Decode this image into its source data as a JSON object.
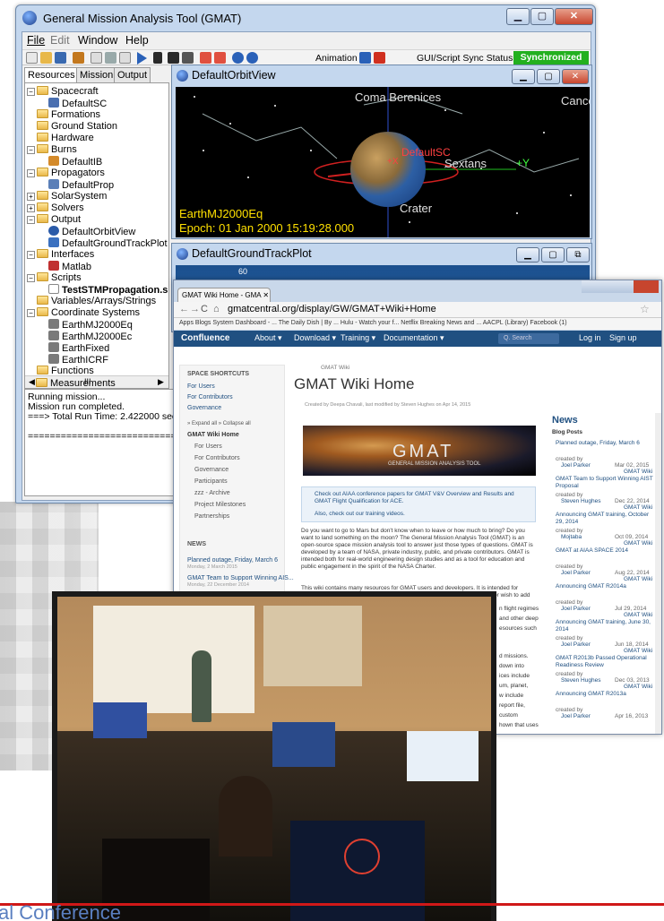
{
  "gmat": {
    "title": "General Mission Analysis Tool (GMAT)",
    "menu": [
      "File",
      "Edit",
      "Window",
      "Help"
    ],
    "toolbar": {
      "animation_label": "Animation",
      "sync_label": "GUI/Script Sync Status:",
      "sync_status": "Synchronized",
      "sync_color": "#22b01f"
    },
    "tabs": [
      "Resources",
      "Mission",
      "Output"
    ],
    "tree": [
      "Spacecraft",
      "DefaultSC",
      "Formations",
      "Ground Station",
      "Hardware",
      "Burns",
      "DefaultIB",
      "Propagators",
      "DefaultProp",
      "SolarSystem",
      "Solvers",
      "Output",
      "DefaultOrbitView",
      "DefaultGroundTrackPlot",
      "Interfaces",
      "Matlab",
      "Scripts",
      "TestSTMPropagation.s",
      "Variables/Arrays/Strings",
      "Coordinate Systems",
      "EarthMJ2000Eq",
      "EarthMJ2000Ec",
      "EarthFixed",
      "EarthICRF",
      "Functions",
      "Measurements"
    ],
    "tree_scroll": "III",
    "output_lines": [
      "Running mission...",
      "Mission run completed.",
      "===> Total Run Time: 2.422000 second",
      "",
      "================================"
    ],
    "orbit_view": {
      "title": "DefaultOrbitView",
      "constellations": [
        "Coma Berenices",
        "Cance",
        "Sextans",
        "Crater"
      ],
      "spacecraft_label": "DefaultSC",
      "axis_label": "+Y",
      "axis_x_label": "+X",
      "coord_label": "EarthMJ2000Eq",
      "epoch_label": "Epoch: 01 Jan 2000 15:19:28.000"
    },
    "ground_track": {
      "title": "DefaultGroundTrackPlot",
      "lat_label": "60"
    }
  },
  "browser": {
    "tab_title": "GMAT Wiki Home - GMA",
    "url": "gmatcentral.org/display/GW/GMAT+Wiki+Home",
    "bookmarks": "Apps   Blogs   System Dashboard - ...   The Daily Dish | By ...   Hulu - Watch your f...   Netflix   Breaking News and ...   AACPL (Library)   Facebook (1)",
    "nav": [
      "Confluence",
      "About ▾",
      "Download ▾",
      "Training ▾",
      "Documentation ▾"
    ],
    "search_placeholder": "Q. Search",
    "login": "Log in",
    "signup": "Sign up",
    "sidebar": {
      "heading": "SPACE SHORTCUTS",
      "shortcuts": [
        "For Users",
        "For Contributors",
        "Governance"
      ],
      "expand": "» Expand all   » Collapse all",
      "tree_title": "GMAT Wiki Home",
      "tree": [
        "For Users",
        "For Contributors",
        "Governance",
        "Participants",
        "zzz - Archive",
        "Project Milestones",
        "Partnerships"
      ],
      "news_heading": "NEWS",
      "news": [
        "Planned outage, Friday, March 6",
        "Monday, 2 March 2015",
        "GMAT Team to Support Winning AIS...",
        "Monday, 22 December 2014"
      ]
    },
    "content": {
      "breadcrumb": "GMAT Wiki",
      "title": "GMAT Wiki Home",
      "byline": "Created by Deepa Chavali, last modified by Steven Hughes on Apr 14, 2015",
      "banner_title": "GMAT",
      "banner_subtitle": "GENERAL MISSION ANALYSIS TOOL",
      "info1": "Check out AIAA conference papers for GMAT V&V Overview and Results and GMAT Flight Qualification for ACE.",
      "info2": "Also, check out our training videos.",
      "para1": "Do you want to go to Mars but don't know when to leave or how much to bring?  Do you want to land something on the moon? The General Mission Analysis Tool (GMAT) is an open-source space mission analysis tool to answer just those types of questions. GMAT is developed by a team of NASA, private industry, public, and private contributors. GMAT is intended both for real-world engineering design studies and as a tool for education and public engagement in the spirit of the NASA Charter.",
      "para2": "This wiki contains many resources for GMAT users and developers. It is intended for collaboration! If you see anything wrong with any of the pages on this wiki, or wish to add GMAT-related information on your own, please feel free to contribute."
    },
    "news": {
      "heading": "News",
      "sub": "Blog Posts",
      "items": [
        {
          "title": "Planned outage, Friday, March 6",
          "by": "created by",
          "author": "Joel Parker",
          "date": "Mar 02, 2015",
          "space": "GMAT Wiki"
        },
        {
          "title": "GMAT Team to Support Winning AIST Proposal",
          "by": "created by",
          "author": "Steven Hughes",
          "date": "Dec 22, 2014",
          "space": "GMAT Wiki"
        },
        {
          "title": "Announcing GMAT training, October 29, 2014",
          "by": "created by",
          "author": "Mojtaba",
          "date": "Oct 09, 2014",
          "space": "GMAT Wiki"
        },
        {
          "title": "GMAT at AIAA SPACE 2014",
          "by": "created by",
          "author": "Joel Parker",
          "date": "Aug 22, 2014",
          "space": "GMAT Wiki"
        },
        {
          "title": "Announcing GMAT R2014a",
          "by": "created by",
          "author": "Joel Parker",
          "date": "Jul 29, 2014",
          "space": "GMAT Wiki"
        },
        {
          "title": "Announcing GMAT training, June 30, 2014",
          "by": "created by",
          "author": "Joel Parker",
          "date": "Jun 18, 2014",
          "space": "GMAT Wiki"
        },
        {
          "title": "GMAT R2013b Passed Operational Readiness Review",
          "by": "created by",
          "author": "Steven Hughes",
          "date": "Dec 03, 2013",
          "space": "GMAT Wiki"
        },
        {
          "title": "Announcing GMAT R2013a",
          "by": "created by",
          "author": "Joel Parker",
          "date": "Apr 16, 2013",
          "space": ""
        }
      ]
    },
    "cut_text": [
      "n flight regimes",
      "and other deep",
      "esources such",
      "d missions.",
      "down into",
      "ices include",
      "um, planet,",
      "w include",
      "report file,",
      "custom",
      "hown that uses"
    ]
  },
  "footer": {
    "conference": "al Conference",
    "line_color": "#d01818"
  }
}
